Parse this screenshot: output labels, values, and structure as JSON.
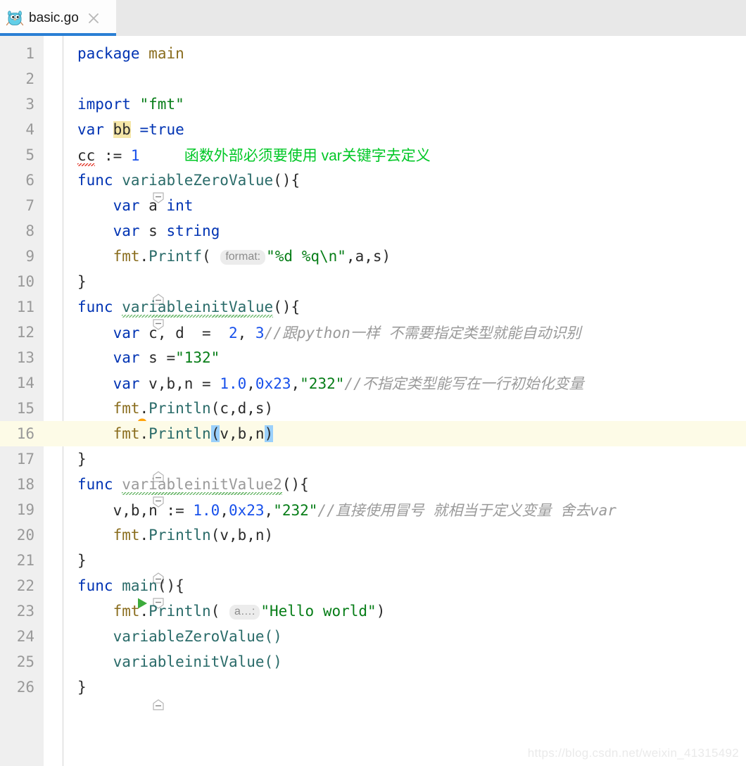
{
  "tab": {
    "filename": "basic.go",
    "icon": "go-gopher-icon",
    "close_label": "×",
    "accent_color": "#2a7fd4"
  },
  "watermark": "https://blog.csdn.net/weixin_41315492",
  "editor": {
    "current_line": 16,
    "line_numbers": [
      "1",
      "2",
      "3",
      "4",
      "5",
      "6",
      "7",
      "8",
      "9",
      "10",
      "11",
      "12",
      "13",
      "14",
      "15",
      "16",
      "17",
      "18",
      "19",
      "20",
      "21",
      "22",
      "23",
      "24",
      "25",
      "26"
    ],
    "lines": [
      {
        "n": "1",
        "text": "package main"
      },
      {
        "n": "2",
        "text": ""
      },
      {
        "n": "3",
        "text": "import \"fmt\""
      },
      {
        "n": "4",
        "text": "var bb =true"
      },
      {
        "n": "5",
        "text": "cc := 1     函数外部必须要使用 var关键字去定义"
      },
      {
        "n": "6",
        "text": "func variableZeroValue(){"
      },
      {
        "n": "7",
        "text": "    var a int"
      },
      {
        "n": "8",
        "text": "    var s string"
      },
      {
        "n": "9",
        "text": "    fmt.Printf( format: \"%d %q\\n\",a,s)"
      },
      {
        "n": "10",
        "text": "}"
      },
      {
        "n": "11",
        "text": "func variableinitValue(){"
      },
      {
        "n": "12",
        "text": "    var c, d  =  2, 3//跟python一样 不需要指定类型就能自动识别"
      },
      {
        "n": "13",
        "text": "    var s =\"132\""
      },
      {
        "n": "14",
        "text": "    var v,b,n = 1.0,0x23,\"232\"//不指定类型能写在一行初始化变量"
      },
      {
        "n": "15",
        "text": "    fmt.Println(c,d,s)"
      },
      {
        "n": "16",
        "text": "    fmt.Println(v,b,n)"
      },
      {
        "n": "17",
        "text": "}"
      },
      {
        "n": "18",
        "text": "func variableinitValue2(){"
      },
      {
        "n": "19",
        "text": "    v,b,n := 1.0,0x23,\"232\"//直接使用冒号 就相当于定义变量 舍去var"
      },
      {
        "n": "20",
        "text": "    fmt.Println(v,b,n)"
      },
      {
        "n": "21",
        "text": "}"
      },
      {
        "n": "22",
        "text": "func main(){"
      },
      {
        "n": "23",
        "text": "    fmt.Println( a…: \"Hello world\")"
      },
      {
        "n": "24",
        "text": "    variableZeroValue()"
      },
      {
        "n": "25",
        "text": "    variableinitValue()"
      },
      {
        "n": "26",
        "text": "}"
      }
    ],
    "tokens": {
      "kw_package": "package",
      "kw_import": "import",
      "kw_var": "var",
      "kw_func": "func",
      "ident_main": "main",
      "str_fmt": "\"fmt\"",
      "ident_bb": "bb",
      "lit_true": "=true",
      "ident_cc": "cc",
      "op_define": " := ",
      "num_1": "1",
      "note_line5": "函数外部必须要使用 var关键字去定义",
      "fn_variableZeroValue": "variableZeroValue",
      "type_int": "int",
      "type_string": "string",
      "ident_a": "a",
      "ident_s": "s",
      "pkg_fmt": "fmt",
      "fn_Printf": "Printf",
      "fn_Println": "Println",
      "hint_format": "format:",
      "hint_a": "a…:",
      "str_format": "\"%d %q\\n\"",
      "fn_variableinitValue": "variableinitValue",
      "fn_variableinitValue2": "variableinitValue2",
      "num_2": "2",
      "num_3": "3",
      "comment_line12": "//跟python一样 不需要指定类型就能自动识别",
      "str_132": "\"132\"",
      "num_1_0": "1.0",
      "num_0x23": "0x23",
      "str_232": "\"232\"",
      "comment_line14": "//不指定类型能写在一行初始化变量",
      "comment_line19": "//直接使用冒号 就相当于定义变量 舍去var",
      "str_hello": "\"Hello world\"",
      "call_variableZeroValue": "variableZeroValue()",
      "call_variableinitValue": "variableinitValue()"
    },
    "colors": {
      "keyword": "#0033b3",
      "string": "#067d17",
      "number": "#1750eb",
      "function": "#2a6b69",
      "package": "#8a6d1e",
      "comment": "#9a9a9a",
      "annotation_green": "#00c726",
      "current_line_bg": "#fdfbe7",
      "identifier_highlight": "#f5e6a8",
      "bracket_highlight": "#9ad0fb",
      "gutter_bg": "#efefef"
    },
    "icons": {
      "fold_collapse": "fold-collapse-icon",
      "fold_end": "fold-end-icon",
      "bulb": "lightbulb-intention-icon",
      "run": "run-gutter-icon"
    }
  }
}
